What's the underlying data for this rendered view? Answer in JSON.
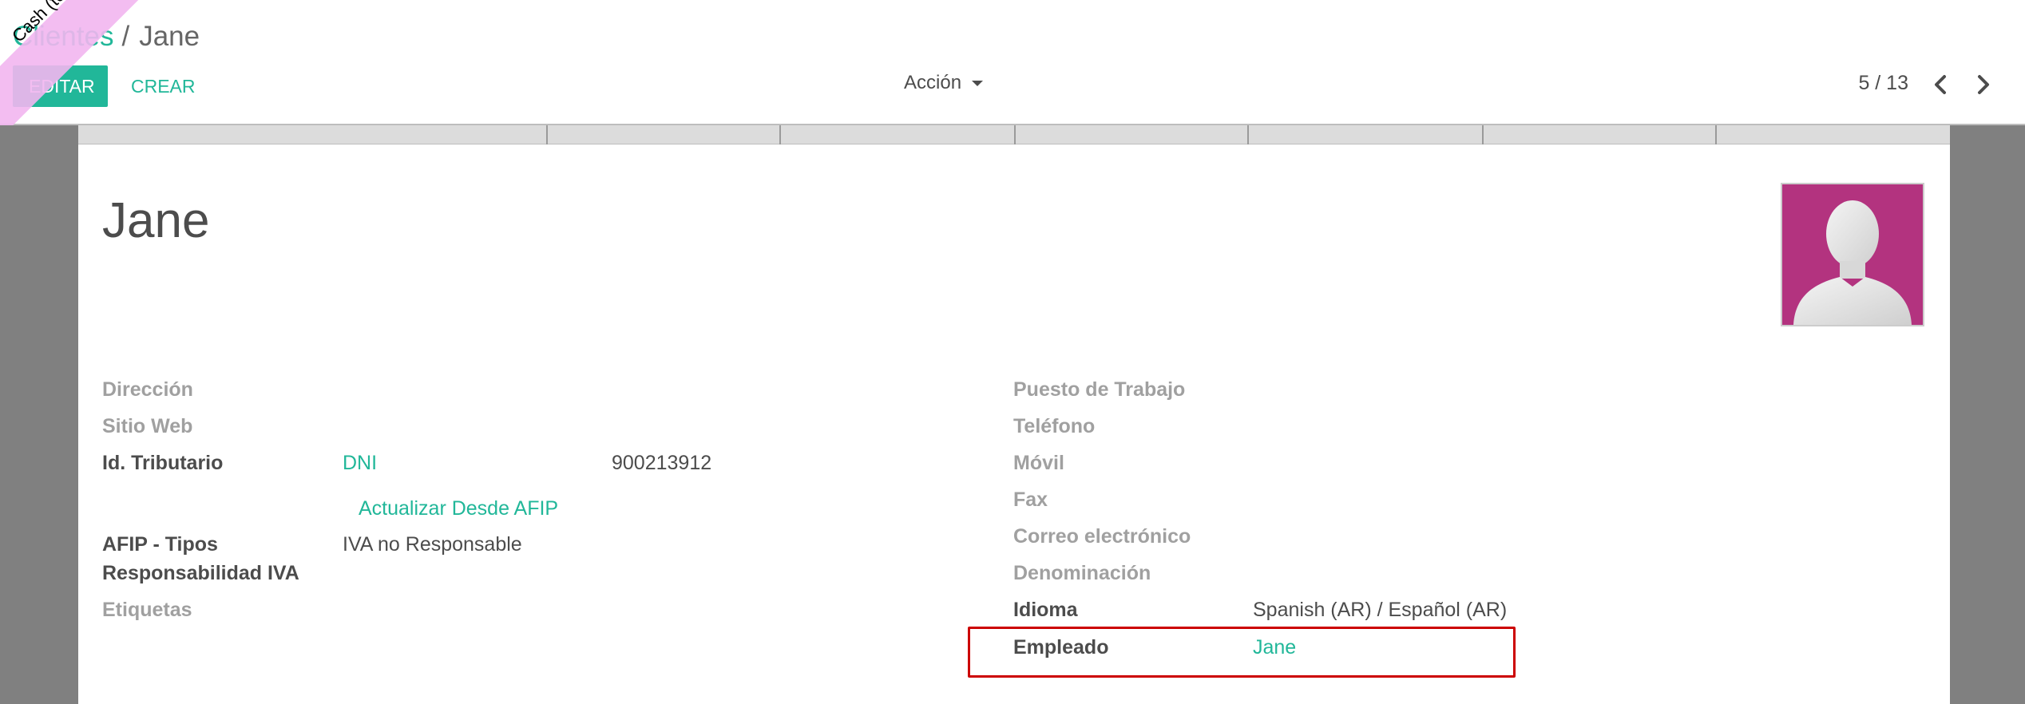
{
  "breadcrumb": {
    "parent": "Clientes",
    "separator": "/",
    "current": "Jane"
  },
  "buttons": {
    "edit": "EDITAR",
    "create": "CREAR"
  },
  "action_menu": {
    "label": "Acción"
  },
  "pager": {
    "value": "5 / 13"
  },
  "ribbon": {
    "text": "Cash (template_to"
  },
  "record": {
    "title": "Jane"
  },
  "left_fields": {
    "direccion_label": "Dirección",
    "sitio_web_label": "Sitio Web",
    "id_tributario_label": "Id. Tributario",
    "id_type": "DNI",
    "id_number": "900213912",
    "afip_update_link": "Actualizar Desde AFIP",
    "afip_label_line1": "AFIP - Tipos",
    "afip_label_line2": "Responsabilidad IVA",
    "afip_value": "IVA no Responsable",
    "etiquetas_label": "Etiquetas"
  },
  "right_fields": {
    "puesto_label": "Puesto de Trabajo",
    "telefono_label": "Teléfono",
    "movil_label": "Móvil",
    "fax_label": "Fax",
    "correo_label": "Correo electrónico",
    "denominacion_label": "Denominación",
    "idioma_label": "Idioma",
    "idioma_value": "Spanish (AR) / Español (AR)",
    "empleado_label": "Empleado",
    "empleado_value": "Jane"
  },
  "colors": {
    "accent": "#21b799",
    "avatar_bg": "#b3337f",
    "highlight": "#cc0000",
    "ribbon": "#f2b6ef"
  },
  "icons": {
    "caret": "caret-down-icon",
    "prev": "chevron-left-icon",
    "next": "chevron-right-icon",
    "avatar": "user-silhouette-icon"
  }
}
